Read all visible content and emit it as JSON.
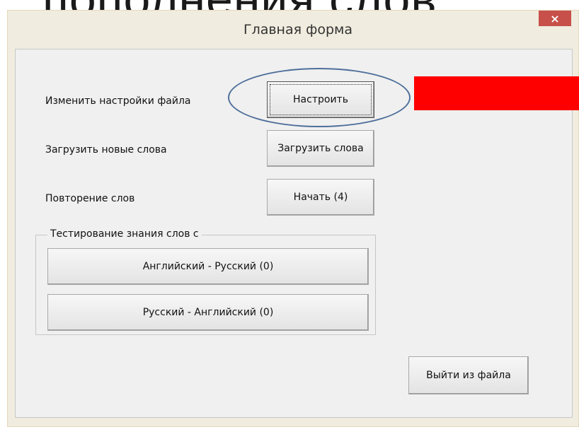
{
  "background_heading": "пополнения слов",
  "window": {
    "title": "Главная форма",
    "close_symbol": "×"
  },
  "rows": [
    {
      "label": "Изменить настройки файла",
      "button": "Настроить"
    },
    {
      "label": "Загрузить новые слова",
      "button": "Загрузить слова"
    },
    {
      "label": "Повторение слов",
      "button": "Начать (4)"
    }
  ],
  "test_group": {
    "legend": "Тестирование знания слов с",
    "buttons": [
      "Английский - Русский (0)",
      "Русский - Английский (0)"
    ]
  },
  "exit_button": "Выйти из файла",
  "annotations": {
    "highlight_color": "#ff0000",
    "oval_color": "#4f6f9b"
  }
}
